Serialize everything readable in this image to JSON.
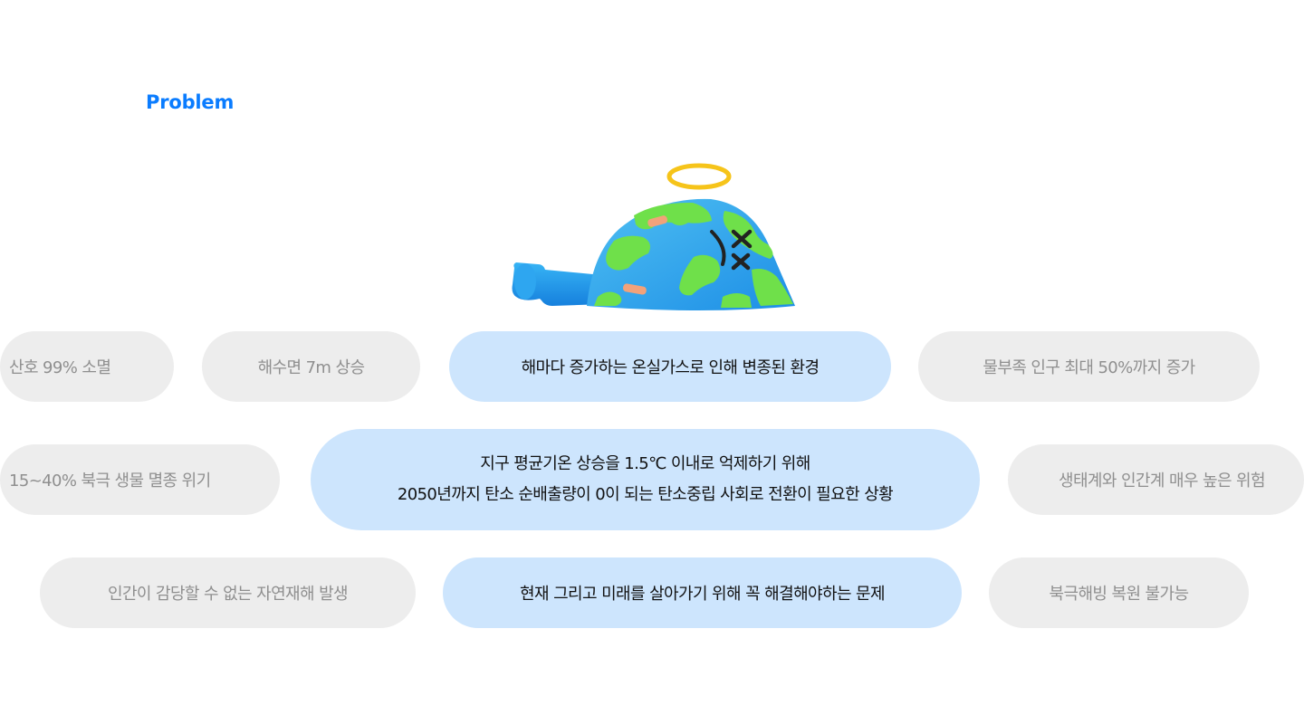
{
  "section": {
    "label": "Problem",
    "accent_color": "#0a7cff"
  },
  "illustration": {
    "icon": "melted-earth-with-halo-icon"
  },
  "row1": {
    "coral": "산호 99% 소멸",
    "sea_level": "해수면 7m 상승",
    "greenhouse": "해마다 증가하는 온실가스로 인해 변종된 환경",
    "water_shortage": "물부족 인구 최대 50%까지 증가"
  },
  "row2": {
    "arctic_species": "15~40% 북극 생물 멸종 위기",
    "main_line1": "지구 평균기온 상승을 1.5℃ 이내로 억제하기 위해",
    "main_line2": "2050년까지 탄소 순배출량이 0이 되는 탄소중립 사회로 전환이 필요한 상황",
    "ecosystem_risk": "생태계와 인간계 매우 높은 위험"
  },
  "row3": {
    "disasters": "인간이 감당할 수 없는 자연재해 발생",
    "present_future": "현재 그리고 미래를 살아가기 위해 꼭 해결해야하는 문제",
    "arctic_ice": "북극해빙 복원 불가능"
  },
  "colors": {
    "highlight_bg": "#cde5fd",
    "muted_bg": "#ededed",
    "muted_text": "#8f8f8f"
  }
}
